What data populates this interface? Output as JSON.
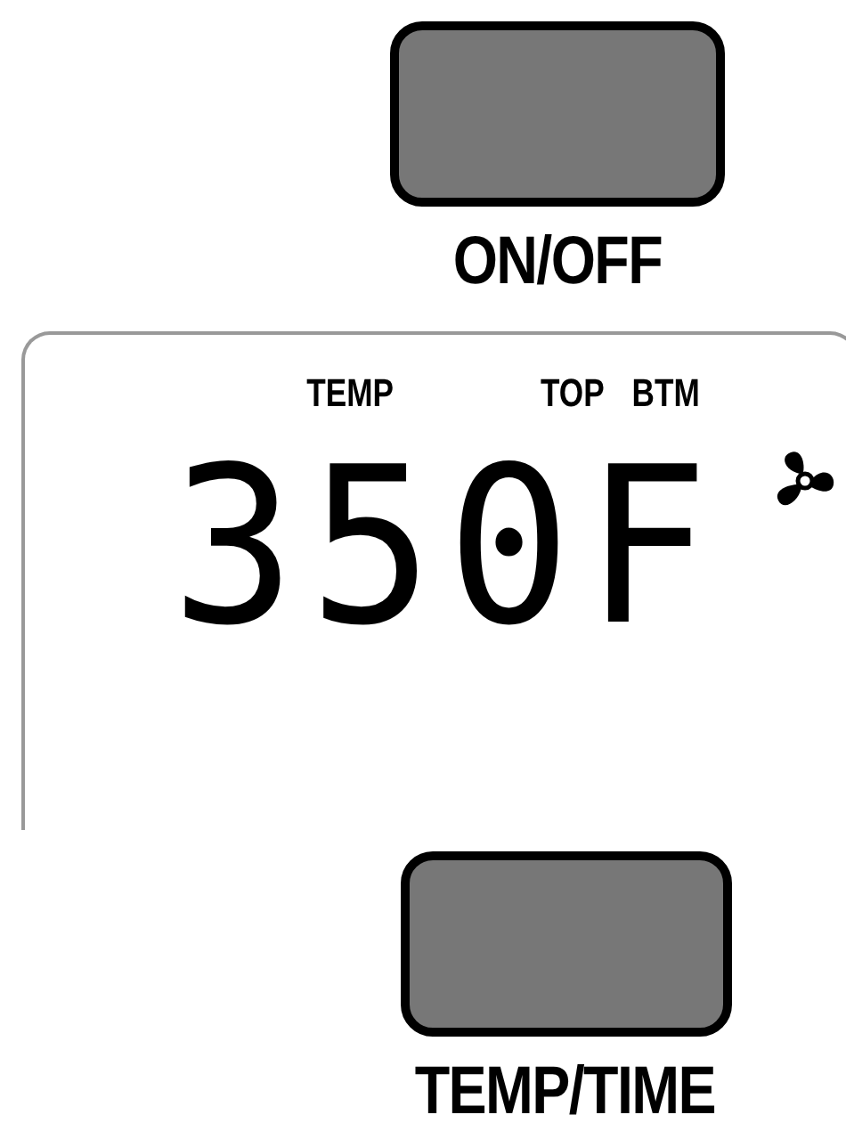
{
  "power_button": {
    "label": "ON/OFF"
  },
  "display": {
    "temp_label": "TEMP",
    "top_label": "TOP",
    "btm_label": "BTM",
    "reading": "350F"
  },
  "temp_time_button": {
    "label": "TEMP/TIME"
  }
}
